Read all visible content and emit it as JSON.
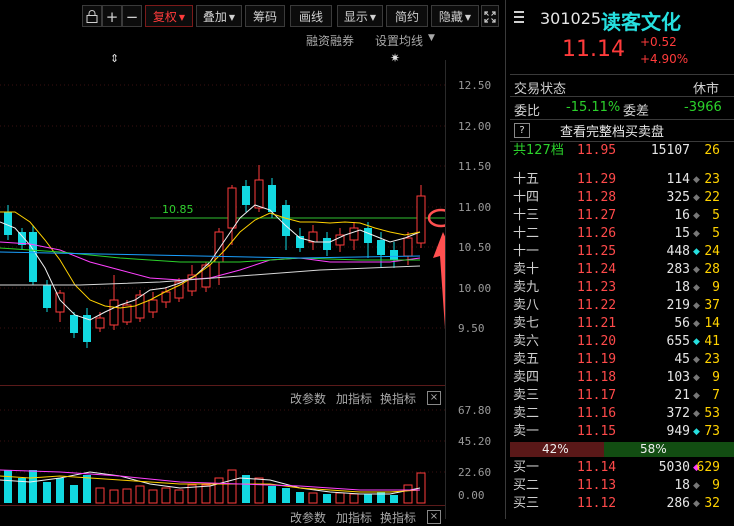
{
  "toolbar": {
    "restore_adj": "复权",
    "overlay": "叠加",
    "chips": "筹码",
    "draw_line": "画线",
    "display": "显示",
    "simple": "简约",
    "hide": "隐藏"
  },
  "main_chart": {
    "links": [
      "融资融券",
      "设置均线"
    ],
    "price_axis": [
      "12.50",
      "12.00",
      "11.50",
      "11.00",
      "10.50",
      "10.00",
      "9.50"
    ],
    "annotation": "10.85"
  },
  "volume_chart": {
    "links": [
      "改参数",
      "加指标",
      "换指标"
    ],
    "axis": [
      "67.80",
      "45.20",
      "22.60",
      "0.00"
    ]
  },
  "bottom_links": [
    "改参数",
    "加指标",
    "换指标"
  ],
  "stock": {
    "code": "301025",
    "name": "读客文化",
    "price": "11.14",
    "change": "+0.52",
    "change_pct": "+4.90%"
  },
  "trade_status": {
    "label": "交易状态",
    "value": "休市"
  },
  "committee": {
    "ratio_label": "委比",
    "ratio": "-15.11%",
    "diff_label": "委差",
    "diff": "-3966"
  },
  "full_book": {
    "help": "?",
    "label": "查看完整档买卖盘"
  },
  "total": {
    "label": "共127档",
    "price": "11.95",
    "volume": "15107",
    "count": "26"
  },
  "asks": [
    {
      "label": "十五",
      "price": "11.29",
      "volume": "114",
      "count": "23",
      "dot": "gray"
    },
    {
      "label": "十四",
      "price": "11.28",
      "volume": "325",
      "count": "22",
      "dot": "gray"
    },
    {
      "label": "十三",
      "price": "11.27",
      "volume": "16",
      "count": "5",
      "dot": "gray"
    },
    {
      "label": "十二",
      "price": "11.26",
      "volume": "15",
      "count": "5",
      "dot": "gray"
    },
    {
      "label": "十一",
      "price": "11.25",
      "volume": "448",
      "count": "24",
      "dot": "cyan"
    },
    {
      "label": "卖十",
      "price": "11.24",
      "volume": "283",
      "count": "28",
      "dot": "gray"
    },
    {
      "label": "卖九",
      "price": "11.23",
      "volume": "18",
      "count": "9",
      "dot": "gray"
    },
    {
      "label": "卖八",
      "price": "11.22",
      "volume": "219",
      "count": "37",
      "dot": "gray"
    },
    {
      "label": "卖七",
      "price": "11.21",
      "volume": "56",
      "count": "14",
      "dot": "gray"
    },
    {
      "label": "卖六",
      "price": "11.20",
      "volume": "655",
      "count": "41",
      "dot": "cyan"
    },
    {
      "label": "卖五",
      "price": "11.19",
      "volume": "45",
      "count": "23",
      "dot": "gray"
    },
    {
      "label": "卖四",
      "price": "11.18",
      "volume": "103",
      "count": "9",
      "dot": "gray"
    },
    {
      "label": "卖三",
      "price": "11.17",
      "volume": "21",
      "count": "7",
      "dot": "gray"
    },
    {
      "label": "卖二",
      "price": "11.16",
      "volume": "372",
      "count": "53",
      "dot": "gray"
    },
    {
      "label": "卖一",
      "price": "11.15",
      "volume": "949",
      "count": "73",
      "dot": "cyan"
    }
  ],
  "ratio_bar": {
    "buy_pct_label": "42%",
    "sell_pct_label": "58%",
    "buy_fraction": 0.42
  },
  "bids": [
    {
      "label": "买一",
      "price": "11.14",
      "volume": "5030",
      "count": "629",
      "dot": "magenta"
    },
    {
      "label": "买二",
      "price": "11.13",
      "volume": "18",
      "count": "9",
      "dot": "gray"
    },
    {
      "label": "买三",
      "price": "11.12",
      "volume": "286",
      "count": "32",
      "dot": "gray"
    }
  ],
  "colors": {
    "up": "#ff3b3b",
    "down": "#12d8e0",
    "accent_cyan": "#26e0e0",
    "yellow": "#ffd200"
  }
}
